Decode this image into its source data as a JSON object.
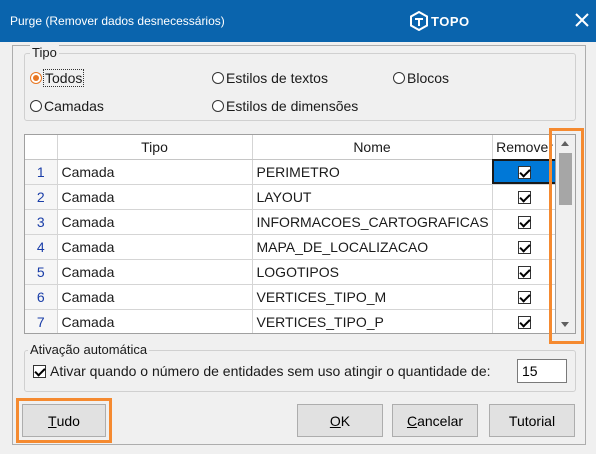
{
  "window": {
    "title": "Purge (Remover dados desnecessários)",
    "brand": "TOPO",
    "brand_icon": "topo-logo-icon",
    "close_icon": "close-icon",
    "accent_color": "#0a64ad"
  },
  "tipo": {
    "legend": "Tipo",
    "options": [
      {
        "label": "Todos",
        "checked": true
      },
      {
        "label": "Estilos de textos",
        "checked": false
      },
      {
        "label": "Blocos",
        "checked": false
      },
      {
        "label": "Camadas",
        "checked": false
      },
      {
        "label": "Estilos de dimensões",
        "checked": false
      }
    ]
  },
  "grid": {
    "columns": [
      "",
      "Tipo",
      "Nome",
      "Remover"
    ],
    "rows": [
      {
        "num": "1",
        "tipo": "Camada",
        "nome": "PERIMETRO",
        "remover": true
      },
      {
        "num": "2",
        "tipo": "Camada",
        "nome": "LAYOUT",
        "remover": true
      },
      {
        "num": "3",
        "tipo": "Camada",
        "nome": "INFORMACOES_CARTOGRAFICAS",
        "remover": true
      },
      {
        "num": "4",
        "tipo": "Camada",
        "nome": "MAPA_DE_LOCALIZACAO",
        "remover": true
      },
      {
        "num": "5",
        "tipo": "Camada",
        "nome": "LOGOTIPOS",
        "remover": true
      },
      {
        "num": "6",
        "tipo": "Camada",
        "nome": "VERTICES_TIPO_M",
        "remover": true
      },
      {
        "num": "7",
        "tipo": "Camada",
        "nome": "VERTICES_TIPO_P",
        "remover": true
      }
    ],
    "highlight_color": "#f58a30"
  },
  "ativacao": {
    "legend": "Ativação automática",
    "checkbox_label": "Ativar quando o número de entidades sem uso atingir o quantidade de:",
    "checked": true,
    "quantity": "15"
  },
  "buttons": {
    "tudo": {
      "mnemonic": "T",
      "rest": "udo"
    },
    "ok": {
      "mnemonic": "O",
      "rest": "K"
    },
    "cancelar": {
      "mnemonic": "C",
      "rest": "ancelar"
    },
    "tutorial": "Tutorial"
  }
}
